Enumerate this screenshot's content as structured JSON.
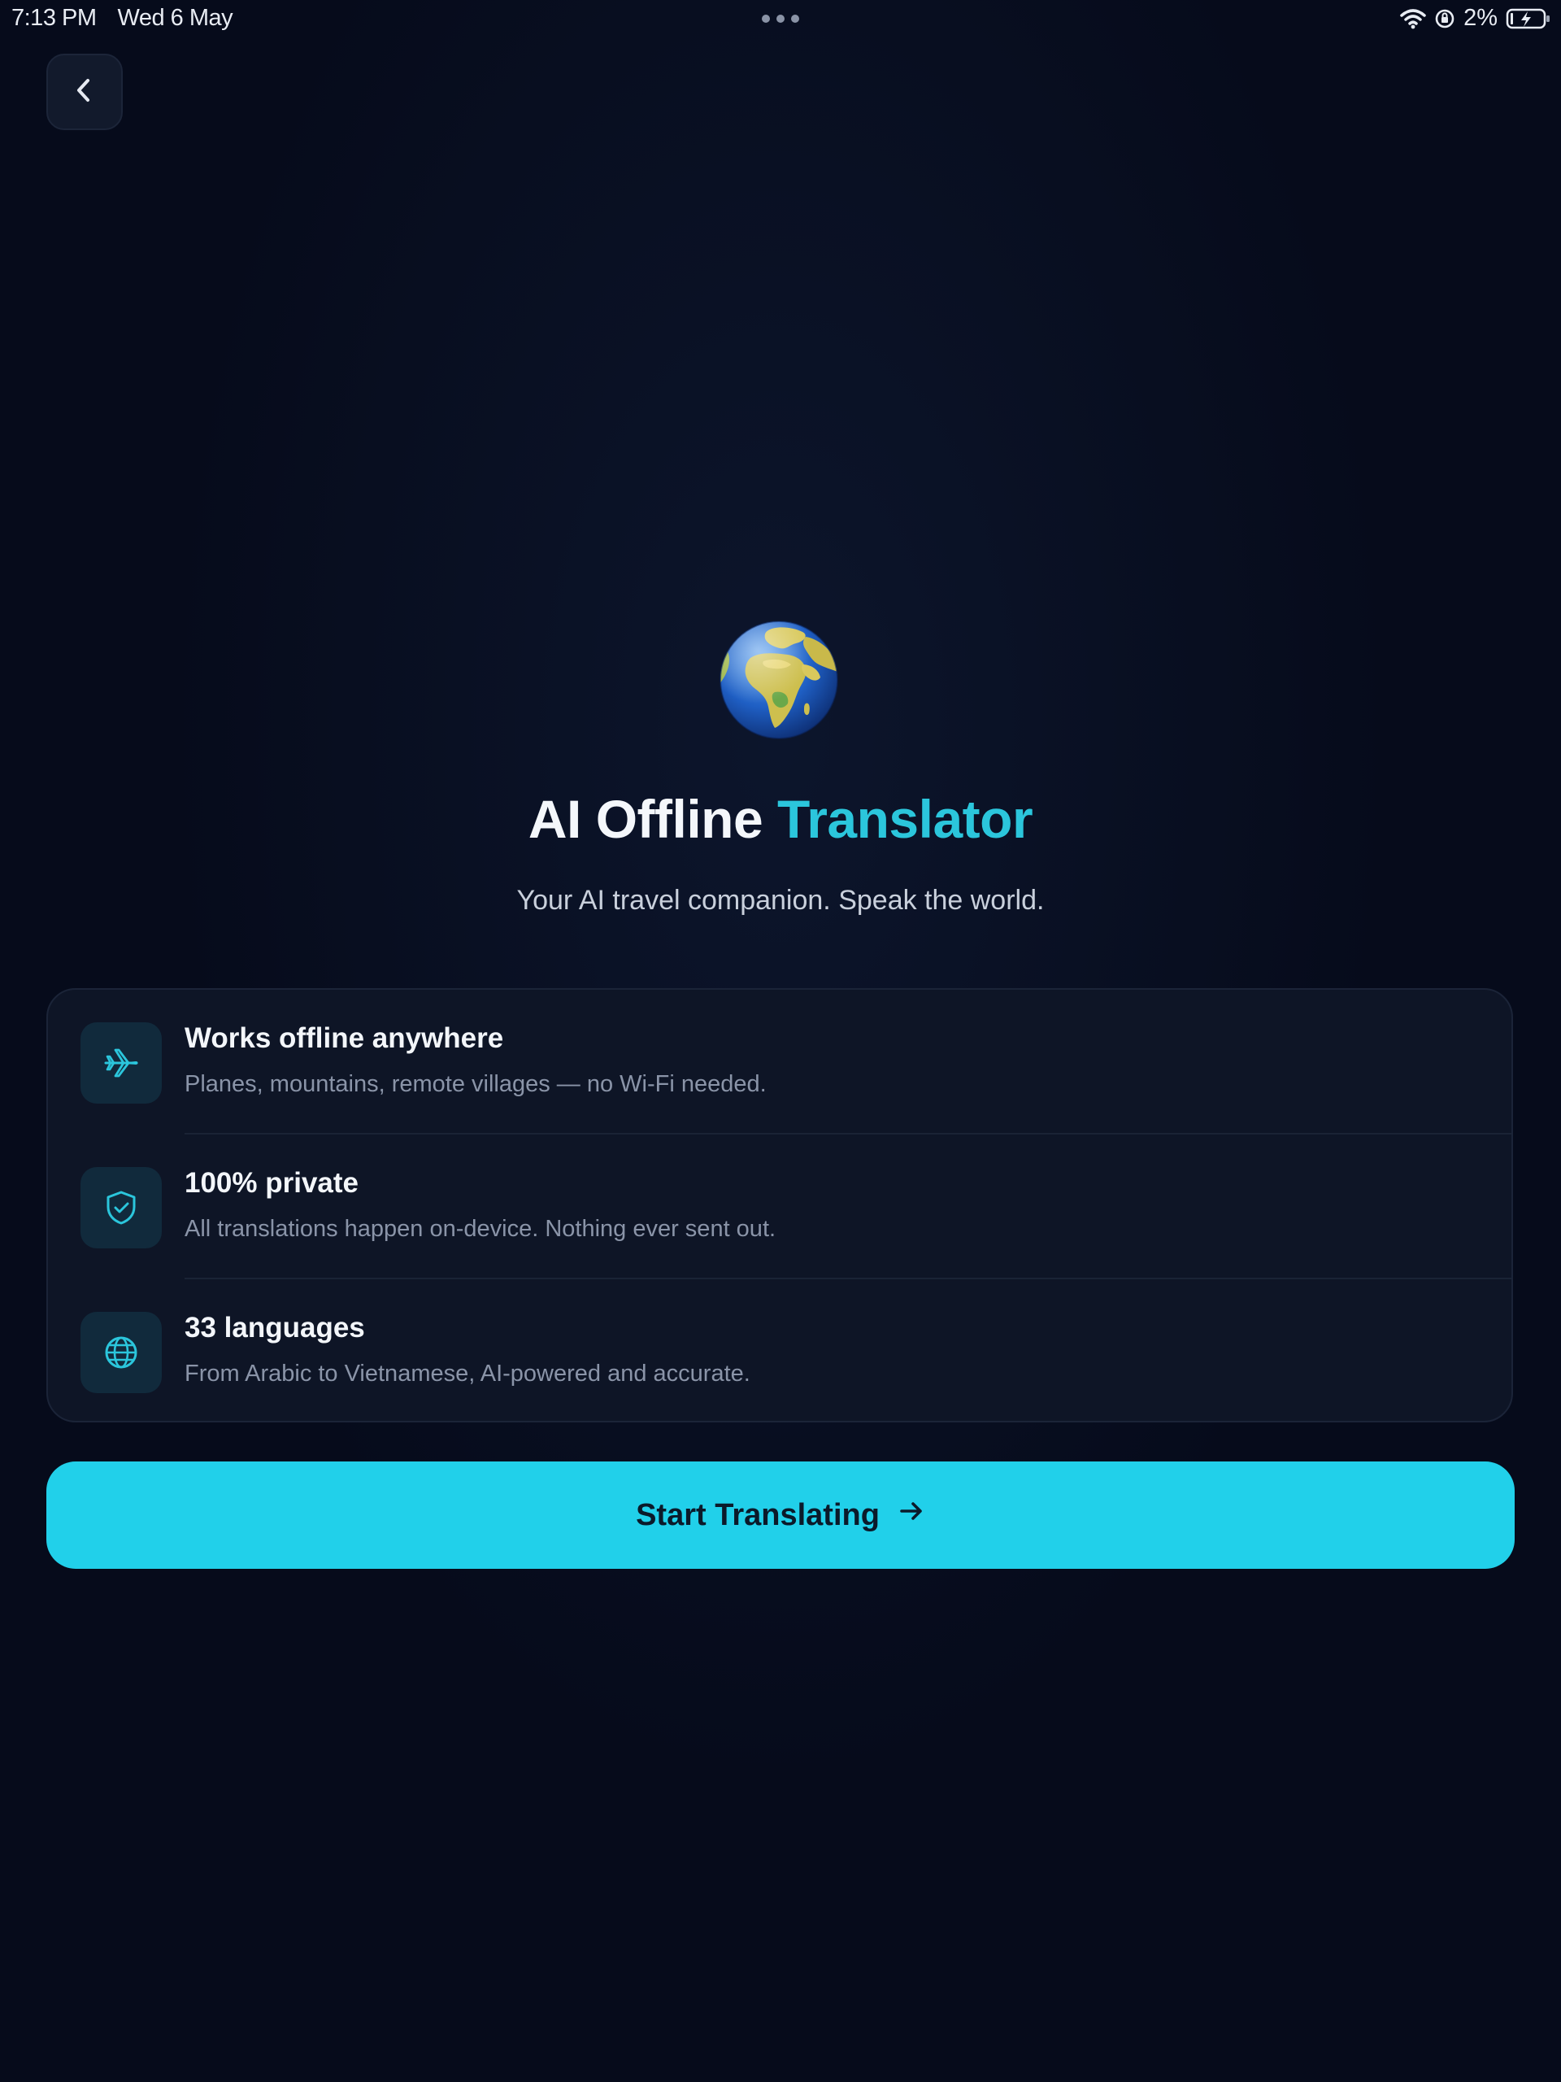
{
  "status_bar": {
    "time": "7:13 PM",
    "date": "Wed 6 May",
    "battery_percent": "2%",
    "icons": [
      "wifi-icon",
      "screen-rotation-lock-icon",
      "battery-charging-icon"
    ]
  },
  "navigation": {
    "back_icon": "chevron-left-icon"
  },
  "hero": {
    "icon": "globe-emoji",
    "title_main": "AI Offline ",
    "title_accent": "Translator",
    "subtitle": "Your AI travel companion. Speak the world."
  },
  "features": [
    {
      "icon": "airplane-icon",
      "title": "Works offline anywhere",
      "description": "Planes, mountains, remote villages — no Wi-Fi needed."
    },
    {
      "icon": "shield-check-icon",
      "title": "100% private",
      "description": "All translations happen on-device. Nothing ever sent out."
    },
    {
      "icon": "globe-icon",
      "title": "33 languages",
      "description": "From Arabic to Vietnamese, AI-powered and accurate."
    }
  ],
  "cta": {
    "label": "Start Translating",
    "icon": "arrow-right-icon"
  },
  "colors": {
    "background": "#060b1b",
    "accent": "#2bc6dc",
    "cta_background": "#21d0ea",
    "card_background": "#0e1526"
  }
}
